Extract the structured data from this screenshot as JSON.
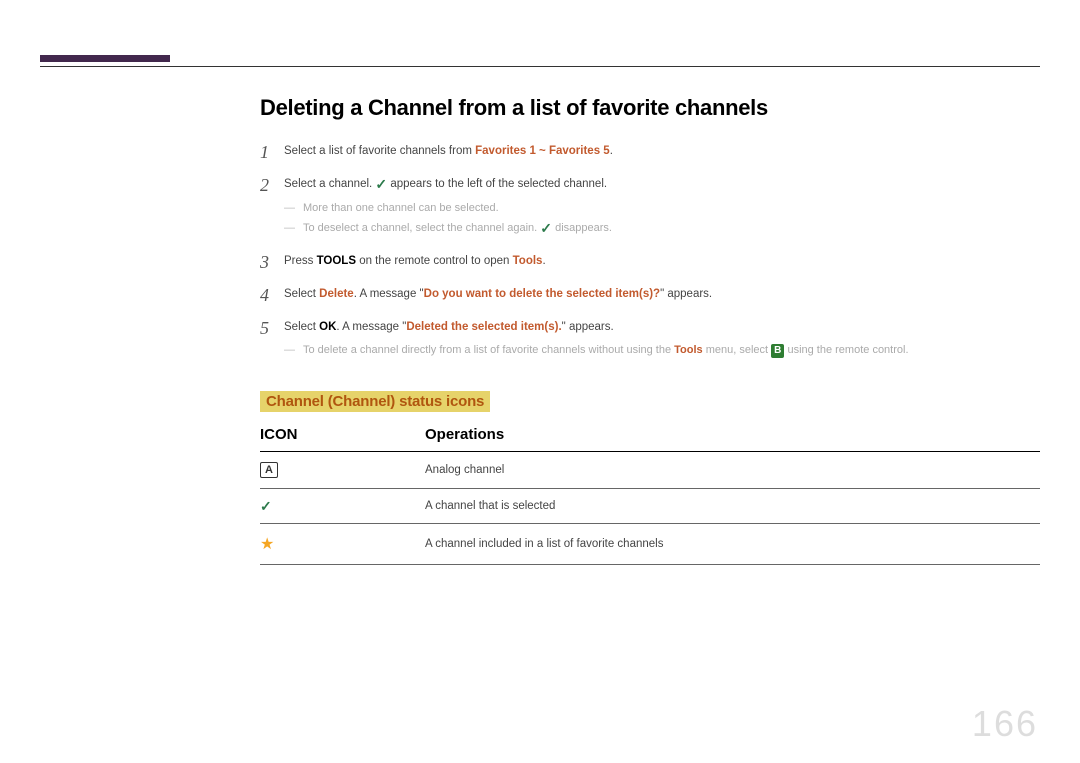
{
  "heading": "Deleting a Channel from a list of favorite channels",
  "steps": {
    "s1_a": "Select a list of favorite channels from ",
    "s1_b": "Favorites 1 ~ Favorites 5",
    "s1_c": ".",
    "s2_a": "Select a channel. ",
    "s2_b": " appears to the left of the selected channel.",
    "s2_note1": "More than one channel can be selected.",
    "s2_note2_a": "To deselect a channel, select the channel again. ",
    "s2_note2_b": " disappears.",
    "s3_a": "Press ",
    "s3_tools": "TOOLS",
    "s3_b": " on the remote control to open ",
    "s3_c": "Tools",
    "s3_d": ".",
    "s4_a": "Select ",
    "s4_delete": "Delete",
    "s4_b": ". A message \"",
    "s4_msg": "Do you want to delete the selected item(s)?",
    "s4_c": "\" appears.",
    "s5_a": "Select ",
    "s5_ok": "OK",
    "s5_b": ". A message \"",
    "s5_msg": "Deleted the selected item(s).",
    "s5_c": "\" appears.",
    "s5_note_a": "To delete a channel directly from a list of favorite channels without using the ",
    "s5_note_tools": "Tools",
    "s5_note_b": " menu, select ",
    "s5_note_badge": "B",
    "s5_note_c": " using the remote control."
  },
  "subheading": "Channel (Channel) status icons",
  "table": {
    "h1": "ICON",
    "h2": "Operations",
    "r1_icon": "A",
    "r1_op": "Analog channel",
    "r2_op": "A channel that is selected",
    "r3_op": "A channel included in a list of favorite channels"
  },
  "page_number": "166"
}
